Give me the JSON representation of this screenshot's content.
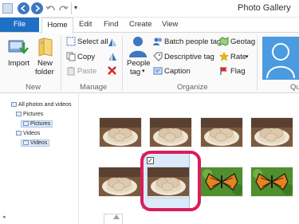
{
  "window": {
    "title": "Photo Gallery"
  },
  "tabs": {
    "file": "File",
    "home": "Home",
    "edit": "Edit",
    "find": "Find",
    "create": "Create",
    "view": "View"
  },
  "ribbon": {
    "new_group": {
      "label": "New",
      "import": "Import",
      "new_folder_line1": "New",
      "new_folder_line2": "folder"
    },
    "manage_group": {
      "label": "Manage",
      "select_all": "Select all",
      "copy": "Copy",
      "paste": "Paste"
    },
    "organize_group": {
      "label": "Organize",
      "people_tag_line1": "People",
      "people_tag_line2": "tag",
      "batch_people_tag": "Batch people tag",
      "descriptive_tag": "Descriptive tag",
      "caption": "Caption",
      "geotag": "Geotag",
      "rate": "Rate",
      "flag": "Flag"
    },
    "quick_group": {
      "label": "Qu"
    }
  },
  "navigation": {
    "items": [
      {
        "label": "All photos and videos",
        "selected": false
      },
      {
        "label": "Pictures",
        "selected": false
      },
      {
        "label": "Pictures",
        "selected": false
      },
      {
        "label": "Videos",
        "selected": false
      },
      {
        "label": "Videos",
        "selected": false
      }
    ]
  },
  "gallery": {
    "thumbnails": [
      {
        "subject": "cookies-on-plate",
        "selected": false
      },
      {
        "subject": "cookies-on-plate",
        "selected": false
      },
      {
        "subject": "cookies-on-plate",
        "selected": false
      },
      {
        "subject": "cookies-on-plate",
        "selected": false
      },
      {
        "subject": "cookies-on-plate",
        "selected": false
      },
      {
        "subject": "cookies-on-plate",
        "selected": true
      },
      {
        "subject": "monarch-butterfly",
        "selected": false
      },
      {
        "subject": "monarch-butterfly",
        "selected": false
      }
    ],
    "selected_check": "✓"
  },
  "colors": {
    "accent": "#1f6fc5",
    "highlight": "#d81e5b",
    "selection": "#dbe9f8"
  }
}
